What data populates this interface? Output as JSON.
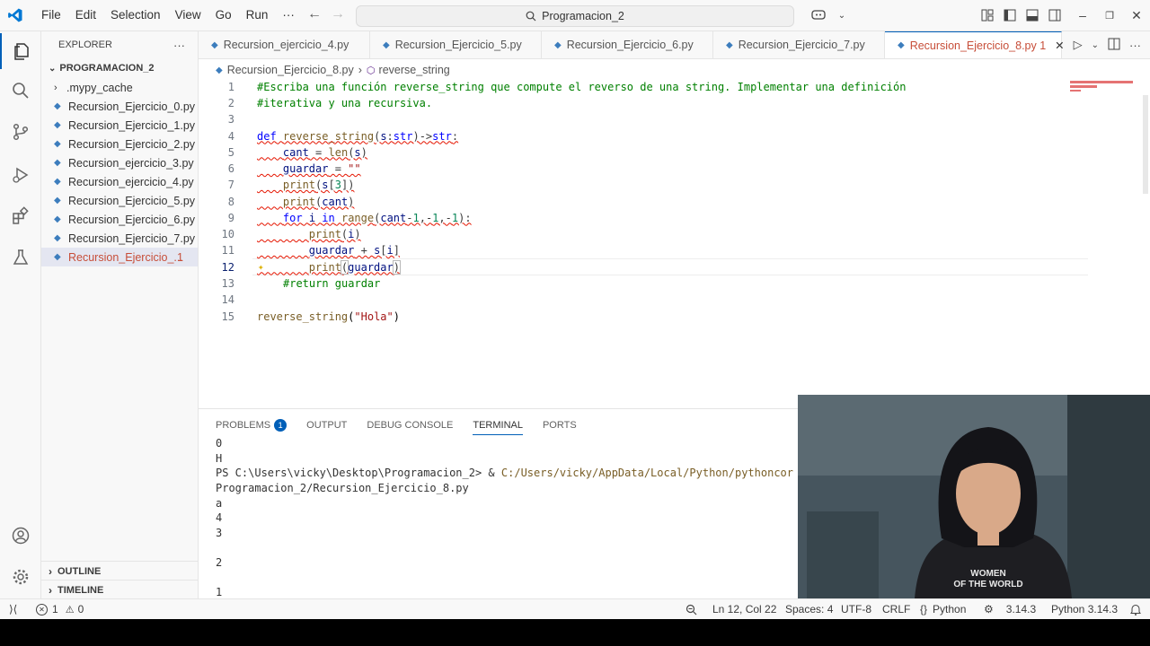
{
  "menu": [
    "File",
    "Edit",
    "Selection",
    "View",
    "Go",
    "Run",
    "···"
  ],
  "search": {
    "text": "Programacion_2"
  },
  "explorer": {
    "title": "EXPLORER",
    "more": "···",
    "folder": "PROGRAMACION_2",
    "items": [
      {
        "label": ".mypy_cache",
        "type": "folder"
      },
      {
        "label": "Recursion_Ejercicio_0.py",
        "type": "py"
      },
      {
        "label": "Recursion_Ejercicio_1.py",
        "type": "py"
      },
      {
        "label": "Recursion_Ejercicio_2.py",
        "type": "py"
      },
      {
        "label": "Recursion_ejercicio_3.py",
        "type": "py"
      },
      {
        "label": "Recursion_ejercicio_4.py",
        "type": "py"
      },
      {
        "label": "Recursion_Ejercicio_5.py",
        "type": "py"
      },
      {
        "label": "Recursion_Ejercicio_6.py",
        "type": "py"
      },
      {
        "label": "Recursion_Ejercicio_7.py",
        "type": "py"
      },
      {
        "label": "Recursion_Ejercicio_...",
        "type": "py",
        "badge": "1"
      }
    ],
    "outline": "OUTLINE",
    "timeline": "TIMELINE"
  },
  "tabs": [
    {
      "label": "Recursion_ejercicio_4.py"
    },
    {
      "label": "Recursion_Ejercicio_5.py"
    },
    {
      "label": "Recursion_Ejercicio_6.py"
    },
    {
      "label": "Recursion_Ejercicio_7.py"
    },
    {
      "label": "Recursion_Ejercicio_8.py 1",
      "close": "✕"
    }
  ],
  "breadcrumb": {
    "file": "Recursion_Ejercicio_8.py",
    "symbol": "reverse_string"
  },
  "code": {
    "l1": "#Escriba una función reverse_string que compute el reverso de una string. Implementar una definición",
    "l2": "#iterativa y una recursiva.",
    "l13": "#return guardar",
    "call_str": "\"Hola\""
  },
  "panel": {
    "tabs": [
      "PROBLEMS",
      "OUTPUT",
      "DEBUG CONSOLE",
      "TERMINAL",
      "PORTS"
    ],
    "problems_count": "1",
    "terminal": [
      "0",
      "H",
      "PS C:\\Users\\vicky\\Desktop\\Programacion_2> & C:/Users/vicky/AppData/Local/Python/pythoncor",
      "Programacion_2/Recursion_Ejercicio_8.py",
      "a",
      "4",
      "3",
      "",
      "2",
      "",
      "1"
    ]
  },
  "webcam": {
    "shirt_text_1": "WOMEN",
    "shirt_text_2": "OF THE WORLD"
  },
  "status": {
    "errors": "1",
    "warnings": "0",
    "position": "Ln 12, Col 22",
    "spaces": "Spaces: 4",
    "encoding": "UTF-8",
    "eol": "CRLF",
    "language": "Python",
    "python_version": "3.14.3",
    "interpreter": "Python 3.14.3"
  },
  "colors": {
    "accent": "#005fb8",
    "active_tab_text": "#c74e39",
    "error": "#e51400"
  }
}
